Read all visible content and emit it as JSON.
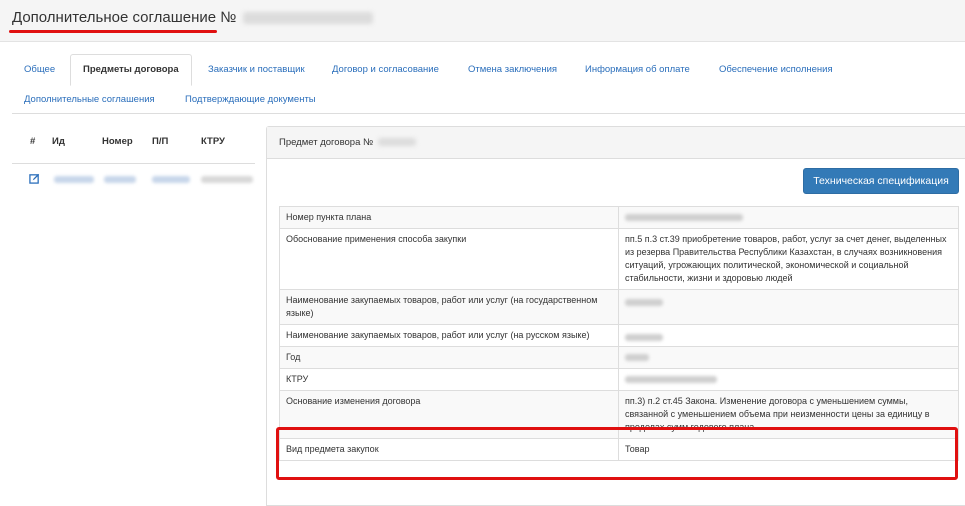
{
  "page": {
    "title": "Дополнительное соглашение №",
    "accent_color": "#e01010",
    "link_color": "#2a6ebb"
  },
  "tabs": [
    {
      "label": "Общее"
    },
    {
      "label": "Предметы договора",
      "active": true
    },
    {
      "label": "Заказчик и поставщик"
    },
    {
      "label": "Договор и согласование"
    },
    {
      "label": "Отмена заключения"
    },
    {
      "label": "Информация об оплате"
    },
    {
      "label": "Обеспечение исполнения"
    },
    {
      "label": "Дополнительные соглашения"
    },
    {
      "label": "Подтверждающие документы"
    }
  ],
  "left_table": {
    "columns": [
      "#",
      "Ид",
      "Номер",
      "П/П",
      "КТРУ"
    ],
    "row_icon": "edit-icon"
  },
  "panel": {
    "title": "Предмет договора №",
    "spec_button": "Техническая спецификация"
  },
  "details": [
    {
      "label": "Номер пункта плана",
      "value": ""
    },
    {
      "label": "Обоснование применения способа закупки",
      "value": "пп.5 п.3 ст.39 приобретение товаров, работ, услуг за счет денег, выделенных из резерва Правительства Республики Казахстан, в случаях возникновения ситуаций, угрожающих политической, экономической и социальной стабильности, жизни и здоровью людей"
    },
    {
      "label": "Наименование закупаемых товаров, работ или услуг (на государственном языке)",
      "value": ""
    },
    {
      "label": "Наименование закупаемых товаров, работ или услуг (на русском языке)",
      "value": ""
    },
    {
      "label": "Год",
      "value": ""
    },
    {
      "label": "КТРУ",
      "value": ""
    },
    {
      "label": "Основание изменения договора",
      "value": "пп.3) п.2 ст.45 Закона. Изменение договора с уменьшением суммы, связанной с уменьшением объема при неизменности цены за единицу в пределах сумм годового плана"
    },
    {
      "label": "Вид предмета закупок",
      "value": "Товар"
    }
  ]
}
